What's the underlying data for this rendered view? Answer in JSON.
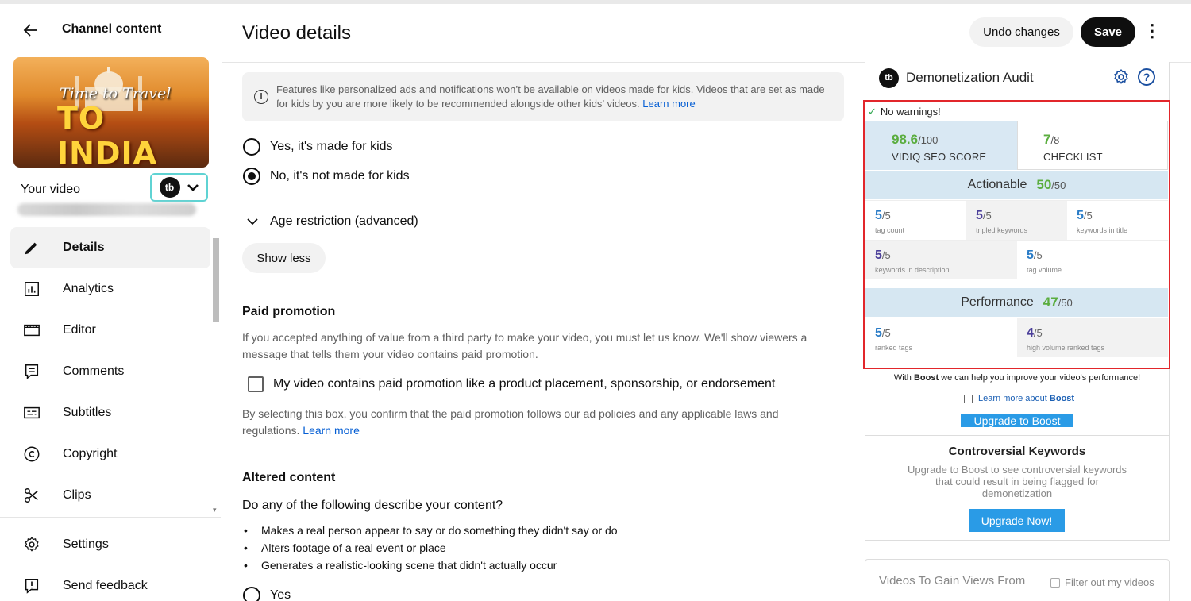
{
  "sidebar": {
    "back_title": "Channel content",
    "thumbnail": {
      "line1": "Time to Travel",
      "line2": "TO INDIA"
    },
    "your_video_label": "Your video",
    "tb_logo": "tb",
    "nav": [
      {
        "label": "Details",
        "icon": "pencil-icon",
        "active": true
      },
      {
        "label": "Analytics",
        "icon": "analytics-icon"
      },
      {
        "label": "Editor",
        "icon": "editor-icon"
      },
      {
        "label": "Comments",
        "icon": "comments-icon"
      },
      {
        "label": "Subtitles",
        "icon": "subtitles-icon"
      },
      {
        "label": "Copyright",
        "icon": "copyright-icon"
      },
      {
        "label": "Clips",
        "icon": "scissors-icon"
      }
    ],
    "nav_bottom": [
      {
        "label": "Settings",
        "icon": "gear-icon"
      },
      {
        "label": "Send feedback",
        "icon": "feedback-icon"
      }
    ]
  },
  "header": {
    "title": "Video details",
    "undo_label": "Undo changes",
    "save_label": "Save"
  },
  "main": {
    "info_text": "Features like personalized ads and notifications won’t be available on videos made for kids. Videos that are set as made for kids by you are more likely to be recommended alongside other kids’ videos.",
    "info_link": "Learn more",
    "kids_yes": "Yes, it's made for kids",
    "kids_no": "No, it's not made for kids",
    "age_restriction": "Age restriction (advanced)",
    "show_less": "Show less",
    "paid_title": "Paid promotion",
    "paid_text": "If you accepted anything of value from a third party to make your video, you must let us know. We'll show viewers a message that tells them your video contains paid promotion.",
    "paid_checkbox": "My video contains paid promotion like a product placement, sponsorship, or endorsement",
    "paid_note": "By selecting this box, you confirm that the paid promotion follows our ad policies and any applicable laws and regulations.",
    "paid_note_link": "Learn more",
    "altered_title": "Altered content",
    "altered_question": "Do any of the following describe your content?",
    "altered_bullets": [
      "Makes a real person appear to say or do something they didn't say or do",
      "Alters footage of a real event or place",
      "Generates a realistic-looking scene that didn't actually occur"
    ],
    "altered_yes": "Yes"
  },
  "vidiq": {
    "logo": "tb",
    "title": "Demonetization Audit",
    "no_warnings": "No warnings!",
    "seo_score": "98.6",
    "seo_score_den": "/100",
    "seo_label": "VIDIQ SEO SCORE",
    "checklist_score": "7",
    "checklist_den": "/8",
    "checklist_label": "CHECKLIST",
    "actionable_label": "Actionable",
    "actionable_score": "50",
    "actionable_den": "/50",
    "actionable_cells": [
      {
        "value": "5",
        "den": "/5",
        "label": "tag count"
      },
      {
        "value": "5",
        "den": "/5",
        "label": "tripled keywords"
      },
      {
        "value": "5",
        "den": "/5",
        "label": "keywords in title"
      },
      {
        "value": "5",
        "den": "/5",
        "label": "keywords in description"
      },
      {
        "value": "5",
        "den": "/5",
        "label": "tag volume"
      }
    ],
    "performance_label": "Performance",
    "performance_score": "47",
    "performance_den": "/50",
    "performance_cells": [
      {
        "value": "5",
        "den": "/5",
        "label": "ranked tags"
      },
      {
        "value": "4",
        "den": "/5",
        "label": "high volume ranked tags"
      }
    ],
    "boost_pre": "With",
    "boost_word": "Boost",
    "boost_post": "we can help you improve your video's performance!",
    "learn_boost_pre": "Learn more about",
    "learn_boost_word": "Boost",
    "upgrade_boost": "Upgrade to Boost",
    "contro_title": "Controversial Keywords",
    "contro_text": "Upgrade to Boost to see controversial keywords that could result in being flagged for demonetization",
    "upgrade_now": "Upgrade Now!",
    "gain_title": "Videos To Gain Views From",
    "filter_label": "Filter out my videos"
  },
  "colors": {
    "green": "#5aad3e",
    "blue": "#2a7cc7",
    "highlight_red": "#e2262b",
    "band": "#d6e7f2"
  }
}
